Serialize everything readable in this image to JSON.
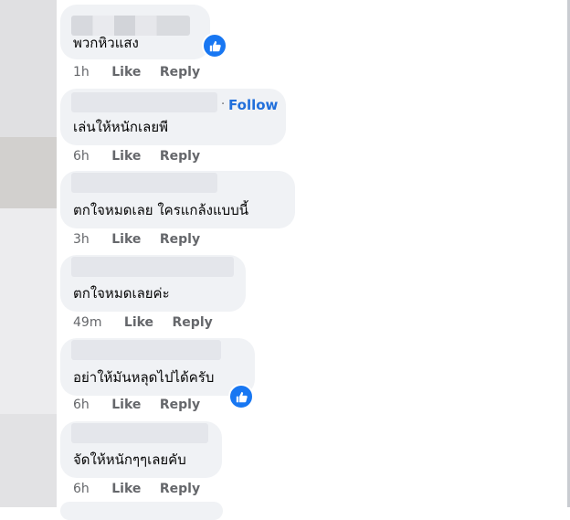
{
  "comments": [
    {
      "text": "พวกหิวแสง",
      "time": "1h",
      "like": "Like",
      "reply": "Reply"
    },
    {
      "text": "เล่นให้หนักเลยพี",
      "time": "6h",
      "like": "Like",
      "reply": "Reply",
      "follow": "Follow"
    },
    {
      "text": "ตกใจหมดเลย ใครแกล้งแบบนี้",
      "time": "3h",
      "like": "Like",
      "reply": "Reply"
    },
    {
      "text": "ตกใจหมดเลยค่ะ",
      "time": "49m",
      "like": "Like",
      "reply": "Reply"
    },
    {
      "text": "อย่าให้มันหลุดไปได้ครับ",
      "time": "6h",
      "like": "Like",
      "reply": "Reply"
    },
    {
      "text": "จัดให้หนักๆๆเลยคับ",
      "time": "6h",
      "like": "Like",
      "reply": "Reply"
    }
  ],
  "colors": {
    "accent": "#1877f2",
    "bubble": "#f0f2f5",
    "meta": "#65676b"
  }
}
